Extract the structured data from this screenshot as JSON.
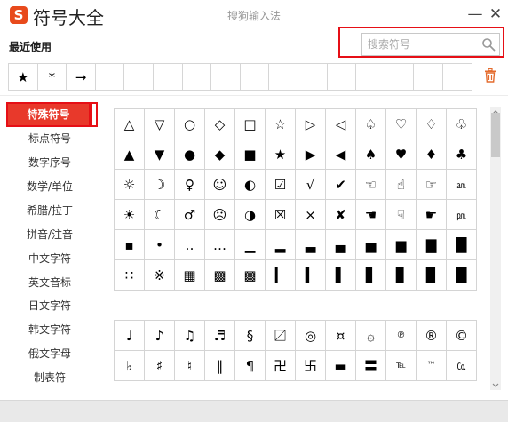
{
  "app": {
    "logo_letter": "S",
    "title": "符号大全",
    "ime_name": "搜狗输入法",
    "minimize": "—",
    "close": "✕"
  },
  "search": {
    "placeholder": "搜索符号",
    "value": "",
    "icon": "search-icon"
  },
  "recent": {
    "label": "最近使用",
    "symbols": [
      "★",
      "*",
      "→",
      "",
      "",
      "",
      "",
      "",
      "",
      "",
      "",
      "",
      "",
      "",
      "",
      ""
    ],
    "clear_icon": "trash-icon"
  },
  "sidebar": {
    "items": [
      {
        "label": "特殊符号",
        "active": true
      },
      {
        "label": "标点符号"
      },
      {
        "label": "数字序号"
      },
      {
        "label": "数学/单位"
      },
      {
        "label": "希腊/拉丁"
      },
      {
        "label": "拼音/注音"
      },
      {
        "label": "中文字符"
      },
      {
        "label": "英文音标"
      },
      {
        "label": "日文字符"
      },
      {
        "label": "韩文字符"
      },
      {
        "label": "俄文字母"
      },
      {
        "label": "制表符"
      }
    ]
  },
  "grid1": {
    "rows": [
      [
        "△",
        "▽",
        "○",
        "◇",
        "□",
        "☆",
        "▷",
        "◁",
        "♤",
        "♡",
        "♢",
        "♧"
      ],
      [
        "▲",
        "▼",
        "●",
        "◆",
        "■",
        "★",
        "▶",
        "◀",
        "♠",
        "♥",
        "♦",
        "♣"
      ],
      [
        "☼",
        "☽",
        "♀",
        "☺",
        "◐",
        "☑",
        "√",
        "✔",
        "☜",
        "☝",
        "☞",
        "㏂"
      ],
      [
        "☀",
        "☾",
        "♂",
        "☹",
        "◑",
        "☒",
        "×",
        "✘",
        "☚",
        "☟",
        "☛",
        "㏘"
      ],
      [
        "▪",
        "•",
        "‥",
        "…",
        "▁",
        "▂",
        "▃",
        "▄",
        "▅",
        "▆",
        "▇",
        "█"
      ],
      [
        "∷",
        "※",
        "▦",
        "▩",
        "▩",
        "▎",
        "▍",
        "▌",
        "▋",
        "▊",
        "▉",
        "█"
      ]
    ]
  },
  "grid2": {
    "rows": [
      [
        "♩",
        "♪",
        "♫",
        "♬",
        "§",
        "〼",
        "◎",
        "¤",
        "۞",
        "℗",
        "®",
        "©"
      ],
      [
        "♭",
        "♯",
        "♮",
        "‖",
        "¶",
        "卍",
        "卐",
        "▬",
        "〓",
        "℡",
        "™",
        "㏇"
      ]
    ]
  }
}
